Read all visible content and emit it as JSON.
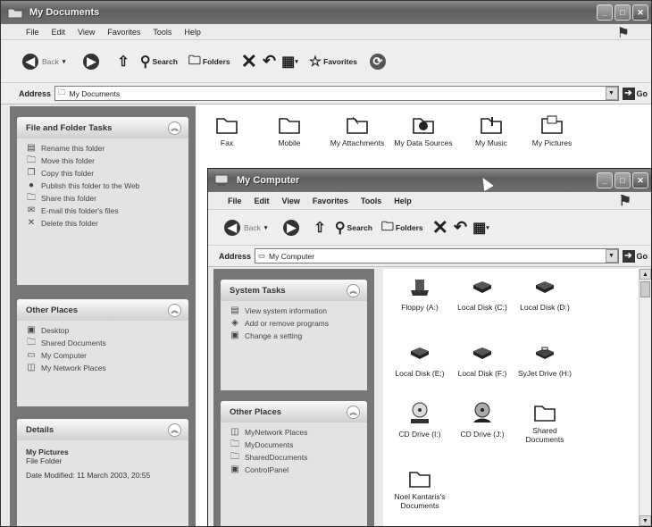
{
  "back_window": {
    "title": "My Documents",
    "menu": [
      "File",
      "Edit",
      "View",
      "Favorites",
      "Tools",
      "Help"
    ],
    "toolbar": {
      "back": "Back",
      "search": "Search",
      "folders": "Folders",
      "favorites": "Favorites"
    },
    "address": {
      "label": "Address",
      "value": "My Documents",
      "go": "Go"
    },
    "file_tasks": {
      "title": "File and Folder Tasks",
      "items": [
        "Rename this folder",
        "Move this folder",
        "Copy this folder",
        "Publish this folder to the Web",
        "Share this folder",
        "E-mail this folder's files",
        "Delete this folder"
      ]
    },
    "other_places": {
      "title": "Other Places",
      "items": [
        "Desktop",
        "Shared Documents",
        "My Computer",
        "My Network Places"
      ]
    },
    "details": {
      "title": "Details",
      "name": "My Pictures",
      "type": "File Folder",
      "modified": "Date Modified: 11 March 2003, 20:55"
    },
    "folders": [
      "Fax",
      "Mobile",
      "My Attachments",
      "My Data Sources",
      "My Music",
      "My Pictures"
    ]
  },
  "front_window": {
    "title": "My Computer",
    "menu": [
      "File",
      "Edit",
      "View",
      "Favorites",
      "Tools",
      "Help"
    ],
    "toolbar": {
      "back": "Back",
      "search": "Search",
      "folders": "Folders"
    },
    "address": {
      "label": "Address",
      "value": "My Computer",
      "go": "Go"
    },
    "system_tasks": {
      "title": "System Tasks",
      "items": [
        "View system information",
        "Add or remove programs",
        "Change a setting"
      ]
    },
    "other_places": {
      "title": "Other Places",
      "items": [
        "MyNetwork Places",
        "MyDocuments",
        "SharedDocuments",
        "ControlPanel"
      ]
    },
    "drives": [
      {
        "label": "Floppy (A:)",
        "icon": "floppy-drive-icon"
      },
      {
        "label": "Local Disk (C:)",
        "icon": "hard-disk-icon"
      },
      {
        "label": "Local Disk (D:)",
        "icon": "hard-disk-icon"
      },
      {
        "label": "Local Disk (E:)",
        "icon": "hard-disk-icon"
      },
      {
        "label": "Local Disk (F:)",
        "icon": "hard-disk-icon"
      },
      {
        "label": "SyJet Drive (H:)",
        "icon": "removable-disk-icon"
      },
      {
        "label": "CD Drive (I:)",
        "icon": "cd-drive-icon"
      },
      {
        "label": "CD Drive (J:)",
        "icon": "shared-cd-icon"
      },
      {
        "label": "Shared Documents",
        "icon": "folder-icon"
      },
      {
        "label": "Noel Kantaris's Documents",
        "icon": "folder-icon"
      }
    ]
  }
}
